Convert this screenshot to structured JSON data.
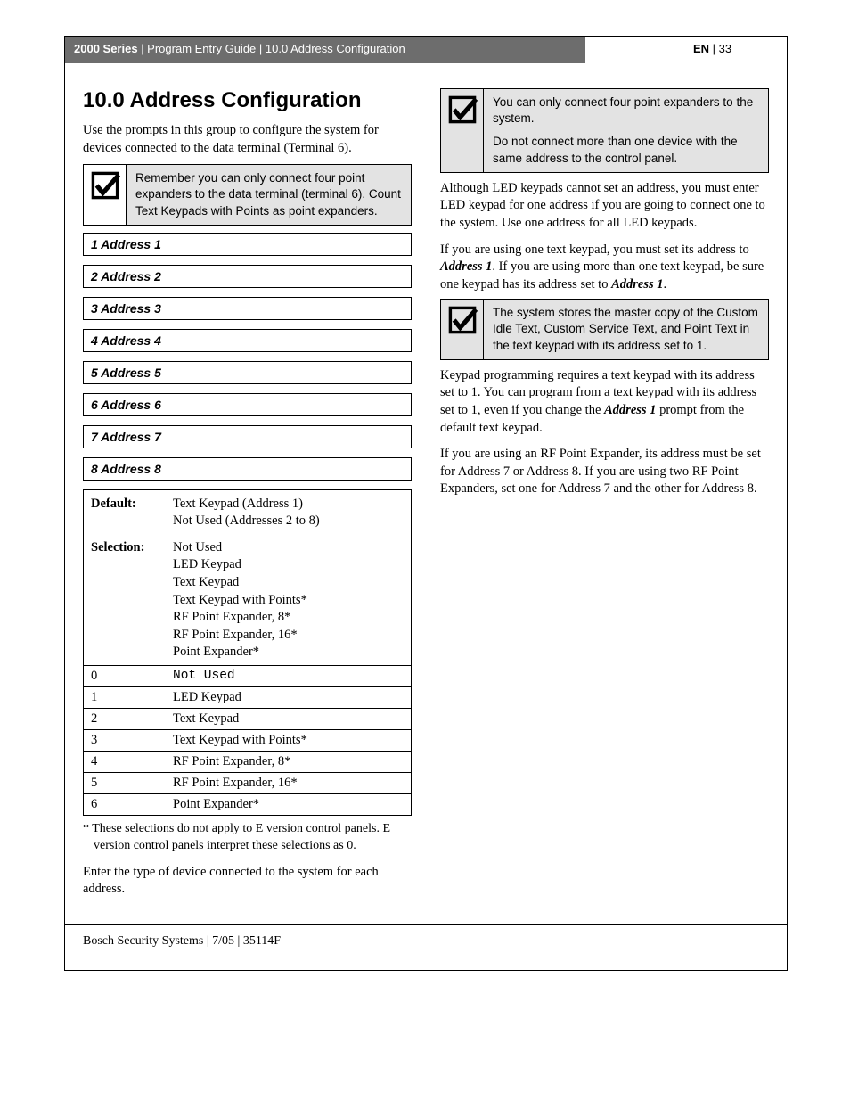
{
  "header": {
    "series": "2000 Series",
    "guide_label": " | Program Entry Guide | 10.0    Address Configuration",
    "lang": "EN",
    "page": " | 33"
  },
  "left": {
    "heading": "10.0 Address Configuration",
    "intro": "Use the prompts in this group to configure the system for devices connected to the data terminal (Terminal 6).",
    "note1": "Remember you can only connect four point expanders to the data terminal (terminal 6). Count Text Keypads with Points as point expanders.",
    "addresses": [
      "1  Address 1",
      "2  Address 2",
      "3  Address 3",
      "4  Address 4",
      "5  Address 5",
      "6  Address 6",
      "7 Address 7",
      "8  Address 8"
    ],
    "param_default_label": "Default:",
    "param_default_val": "Text Keypad (Address 1)\nNot Used (Addresses 2 to 8)",
    "param_sel_label": "Selection:",
    "param_sel_val": "Not Used\nLED Keypad\nText Keypad\nText Keypad with Points*\nRF Point Expander, 8*\nRF Point Expander, 16*\nPoint Expander*",
    "rows": [
      {
        "k": "0",
        "v": "Not Used",
        "mono": true
      },
      {
        "k": "1",
        "v": "LED Keypad"
      },
      {
        "k": "2",
        "v": "Text Keypad"
      },
      {
        "k": "3",
        "v": "Text Keypad with Points*"
      },
      {
        "k": "4",
        "v": "RF Point Expander, 8*"
      },
      {
        "k": "5",
        "v": "RF Point Expander, 16*"
      },
      {
        "k": "6",
        "v": "Point Expander*"
      }
    ],
    "footnote": "* These selections do not apply to E version control panels. E version control panels interpret these selections as 0.",
    "enter": "Enter the type of device connected to the system for each address."
  },
  "right": {
    "note2a": "You can only connect four point expanders to the system.",
    "note2b": "Do not connect more than one device with the same address to the control panel.",
    "p1": "Although LED keypads cannot set an address, you must enter LED keypad for one address if you are going to connect one to the system. Use one address for all LED keypads.",
    "p2a": "If you are using one text keypad, you must set its address to ",
    "p2b": "Address 1",
    "p2c": ". If you are using more than one text keypad, be sure one keypad has its address set to ",
    "p2d": "Address 1",
    "p2e": ".",
    "note3": "The system stores the master copy of the Custom Idle Text, Custom Service Text, and Point Text in the text keypad with its address set to 1.",
    "p3a": "Keypad programming requires a text keypad with its address set to 1. You can program from a text keypad with its address set to 1, even if you change the ",
    "p3b": "Address 1",
    "p3c": " prompt from the default text keypad.",
    "p4": "If you are using an RF Point Expander, its address must be set for Address 7 or Address 8. If you are using two RF Point Expanders, set one for Address 7 and the other for Address 8."
  },
  "footer": "Bosch Security Systems | 7/05 | 35114F"
}
